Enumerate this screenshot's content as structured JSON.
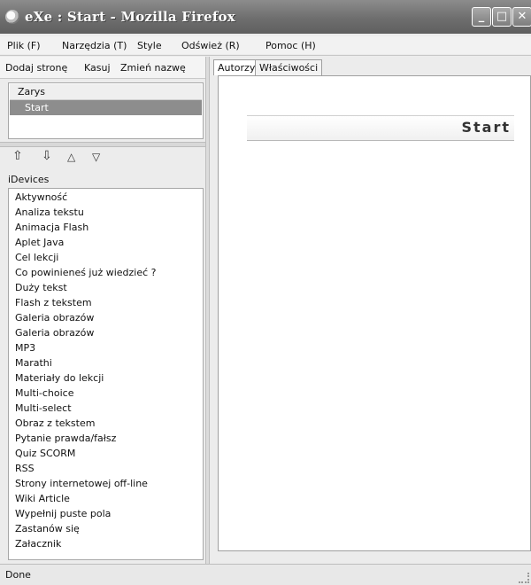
{
  "window": {
    "title": "eXe : Start - Mozilla Firefox"
  },
  "menu": {
    "items": [
      "Plik (F)",
      "Narzędzia (T)",
      "Style",
      "Odśwież (R)",
      "Pomoc (H)"
    ]
  },
  "outline_toolbar": {
    "add_page": "Dodaj stronę",
    "delete": "Kasuj",
    "rename": "Zmień nazwę"
  },
  "outline": {
    "header": "Zarys",
    "selected": "Start"
  },
  "idevices": {
    "label": "iDevices",
    "items": [
      "Aktywność",
      "Analiza tekstu",
      "Animacja Flash",
      "Aplet Java",
      "Cel lekcji",
      "Co powinieneś już wiedzieć ?",
      "Duży tekst",
      "Flash z tekstem",
      "Galeria obrazów",
      "Galeria obrazów",
      "MP3",
      "Marathi",
      "Materiały do lekcji",
      "Multi-choice",
      "Multi-select",
      "Obraz z tekstem",
      "Pytanie prawda/fałsz",
      "Quiz SCORM",
      "RSS",
      "Strony internetowej off-line",
      "Wiki Article",
      "Wypełnij puste pola",
      "Zastanów się",
      "Załacznik"
    ]
  },
  "tabs": [
    "Autorzy",
    "Właściwości"
  ],
  "content": {
    "page_title": "Start"
  },
  "status": {
    "text": "Done"
  },
  "icons": {
    "arrows": [
      "promote-icon",
      "demote-icon",
      "move-up-icon",
      "move-down-icon"
    ]
  }
}
